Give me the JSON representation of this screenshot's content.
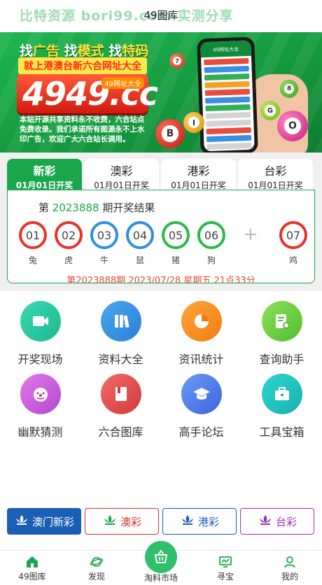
{
  "header": {
    "title": "49图库",
    "watermark": "比特资源 bori99.com 实测分享"
  },
  "banner": {
    "line1_a": "找",
    "line1_b": "广告",
    "line1_c": " 找",
    "line1_d": "模式",
    "line1_e": " 找",
    "line1_f": "特码",
    "line2": "就上港澳台新六合网址大全",
    "domain": "4949.cc",
    "tag": "49网址大全",
    "note": "本站开源共享资料永不收费，六合站点免费收录。我们承诺所有图源永不上水印广告，欢迎广大六合站长调用。",
    "phone_title": "49网址大全"
  },
  "lottery_tabs": [
    {
      "name": "新彩",
      "date": "01月01日开奖",
      "active": true
    },
    {
      "name": "澳彩",
      "date": "01月01日开奖",
      "active": false
    },
    {
      "name": "港彩",
      "date": "01月01日开奖",
      "active": false
    },
    {
      "name": "台彩",
      "date": "01月01日开奖",
      "active": false
    }
  ],
  "result": {
    "period_prefix": "第 ",
    "period_num": "2023888",
    "period_suffix": " 期开奖结果",
    "balls": [
      {
        "num": "01",
        "zodiac": "兔",
        "color": "#e8322b"
      },
      {
        "num": "02",
        "zodiac": "虎",
        "color": "#e8322b"
      },
      {
        "num": "03",
        "zodiac": "牛",
        "color": "#2f8fe0"
      },
      {
        "num": "04",
        "zodiac": "鼠",
        "color": "#2f8fe0"
      },
      {
        "num": "05",
        "zodiac": "猪",
        "color": "#2db84a"
      },
      {
        "num": "06",
        "zodiac": "狗",
        "color": "#2db84a"
      }
    ],
    "plus": "+",
    "special": {
      "num": "07",
      "zodiac": "鸡",
      "color": "#e8322b"
    },
    "next_time": "第2023888期 2023/07/28 星期五 21点33分"
  },
  "features": [
    {
      "label": "开奖现场",
      "icon": "video-icon",
      "color_a": "#3ad7b3",
      "color_b": "#1db98f"
    },
    {
      "label": "资料大全",
      "icon": "books-icon",
      "color_a": "#4aa7ef",
      "color_b": "#2a7fd6"
    },
    {
      "label": "资讯统计",
      "icon": "pie-chart-icon",
      "color_a": "#ffa53a",
      "color_b": "#f07d12"
    },
    {
      "label": "查询助手",
      "icon": "search-doc-icon",
      "color_a": "#8fe05a",
      "color_b": "#4fbf2e"
    },
    {
      "label": "幽默猜测",
      "icon": "clown-icon",
      "color_a": "#e27ae8",
      "color_b": "#b446d1"
    },
    {
      "label": "六合图库",
      "icon": "album-icon",
      "color_a": "#f26a6a",
      "color_b": "#d23b3b"
    },
    {
      "label": "高手论坛",
      "icon": "graduation-cap-icon",
      "color_a": "#6a9cf5",
      "color_b": "#3d63e0"
    },
    {
      "label": "工具宝箱",
      "icon": "toolbox-icon",
      "color_a": "#2fd6d0",
      "color_b": "#16b1ad"
    }
  ],
  "lot_buttons": [
    {
      "label": "澳门新彩",
      "color": "#1a5fb4",
      "filled": true
    },
    {
      "label": "澳彩",
      "color": "#d9332b",
      "filled": false
    },
    {
      "label": "港彩",
      "color": "#1a5fb4",
      "filled": false
    },
    {
      "label": "台彩",
      "color": "#9b2fb6",
      "filled": false
    }
  ],
  "nav": {
    "home": "49图库",
    "discover": "发现",
    "market": "淘料市场",
    "treasure": "寻宝",
    "me": "我的"
  }
}
